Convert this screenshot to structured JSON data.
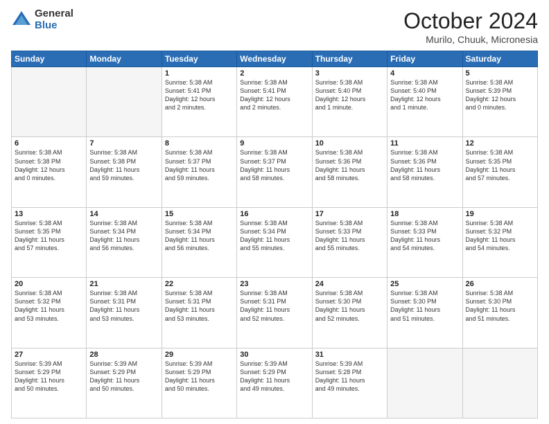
{
  "header": {
    "logo_general": "General",
    "logo_blue": "Blue",
    "title": "October 2024",
    "location": "Murilo, Chuuk, Micronesia"
  },
  "days_of_week": [
    "Sunday",
    "Monday",
    "Tuesday",
    "Wednesday",
    "Thursday",
    "Friday",
    "Saturday"
  ],
  "weeks": [
    [
      {
        "day": "",
        "info": ""
      },
      {
        "day": "",
        "info": ""
      },
      {
        "day": "1",
        "info": "Sunrise: 5:38 AM\nSunset: 5:41 PM\nDaylight: 12 hours\nand 2 minutes."
      },
      {
        "day": "2",
        "info": "Sunrise: 5:38 AM\nSunset: 5:41 PM\nDaylight: 12 hours\nand 2 minutes."
      },
      {
        "day": "3",
        "info": "Sunrise: 5:38 AM\nSunset: 5:40 PM\nDaylight: 12 hours\nand 1 minute."
      },
      {
        "day": "4",
        "info": "Sunrise: 5:38 AM\nSunset: 5:40 PM\nDaylight: 12 hours\nand 1 minute."
      },
      {
        "day": "5",
        "info": "Sunrise: 5:38 AM\nSunset: 5:39 PM\nDaylight: 12 hours\nand 0 minutes."
      }
    ],
    [
      {
        "day": "6",
        "info": "Sunrise: 5:38 AM\nSunset: 5:38 PM\nDaylight: 12 hours\nand 0 minutes."
      },
      {
        "day": "7",
        "info": "Sunrise: 5:38 AM\nSunset: 5:38 PM\nDaylight: 11 hours\nand 59 minutes."
      },
      {
        "day": "8",
        "info": "Sunrise: 5:38 AM\nSunset: 5:37 PM\nDaylight: 11 hours\nand 59 minutes."
      },
      {
        "day": "9",
        "info": "Sunrise: 5:38 AM\nSunset: 5:37 PM\nDaylight: 11 hours\nand 58 minutes."
      },
      {
        "day": "10",
        "info": "Sunrise: 5:38 AM\nSunset: 5:36 PM\nDaylight: 11 hours\nand 58 minutes."
      },
      {
        "day": "11",
        "info": "Sunrise: 5:38 AM\nSunset: 5:36 PM\nDaylight: 11 hours\nand 58 minutes."
      },
      {
        "day": "12",
        "info": "Sunrise: 5:38 AM\nSunset: 5:35 PM\nDaylight: 11 hours\nand 57 minutes."
      }
    ],
    [
      {
        "day": "13",
        "info": "Sunrise: 5:38 AM\nSunset: 5:35 PM\nDaylight: 11 hours\nand 57 minutes."
      },
      {
        "day": "14",
        "info": "Sunrise: 5:38 AM\nSunset: 5:34 PM\nDaylight: 11 hours\nand 56 minutes."
      },
      {
        "day": "15",
        "info": "Sunrise: 5:38 AM\nSunset: 5:34 PM\nDaylight: 11 hours\nand 56 minutes."
      },
      {
        "day": "16",
        "info": "Sunrise: 5:38 AM\nSunset: 5:34 PM\nDaylight: 11 hours\nand 55 minutes."
      },
      {
        "day": "17",
        "info": "Sunrise: 5:38 AM\nSunset: 5:33 PM\nDaylight: 11 hours\nand 55 minutes."
      },
      {
        "day": "18",
        "info": "Sunrise: 5:38 AM\nSunset: 5:33 PM\nDaylight: 11 hours\nand 54 minutes."
      },
      {
        "day": "19",
        "info": "Sunrise: 5:38 AM\nSunset: 5:32 PM\nDaylight: 11 hours\nand 54 minutes."
      }
    ],
    [
      {
        "day": "20",
        "info": "Sunrise: 5:38 AM\nSunset: 5:32 PM\nDaylight: 11 hours\nand 53 minutes."
      },
      {
        "day": "21",
        "info": "Sunrise: 5:38 AM\nSunset: 5:31 PM\nDaylight: 11 hours\nand 53 minutes."
      },
      {
        "day": "22",
        "info": "Sunrise: 5:38 AM\nSunset: 5:31 PM\nDaylight: 11 hours\nand 53 minutes."
      },
      {
        "day": "23",
        "info": "Sunrise: 5:38 AM\nSunset: 5:31 PM\nDaylight: 11 hours\nand 52 minutes."
      },
      {
        "day": "24",
        "info": "Sunrise: 5:38 AM\nSunset: 5:30 PM\nDaylight: 11 hours\nand 52 minutes."
      },
      {
        "day": "25",
        "info": "Sunrise: 5:38 AM\nSunset: 5:30 PM\nDaylight: 11 hours\nand 51 minutes."
      },
      {
        "day": "26",
        "info": "Sunrise: 5:38 AM\nSunset: 5:30 PM\nDaylight: 11 hours\nand 51 minutes."
      }
    ],
    [
      {
        "day": "27",
        "info": "Sunrise: 5:39 AM\nSunset: 5:29 PM\nDaylight: 11 hours\nand 50 minutes."
      },
      {
        "day": "28",
        "info": "Sunrise: 5:39 AM\nSunset: 5:29 PM\nDaylight: 11 hours\nand 50 minutes."
      },
      {
        "day": "29",
        "info": "Sunrise: 5:39 AM\nSunset: 5:29 PM\nDaylight: 11 hours\nand 50 minutes."
      },
      {
        "day": "30",
        "info": "Sunrise: 5:39 AM\nSunset: 5:29 PM\nDaylight: 11 hours\nand 49 minutes."
      },
      {
        "day": "31",
        "info": "Sunrise: 5:39 AM\nSunset: 5:28 PM\nDaylight: 11 hours\nand 49 minutes."
      },
      {
        "day": "",
        "info": ""
      },
      {
        "day": "",
        "info": ""
      }
    ]
  ]
}
